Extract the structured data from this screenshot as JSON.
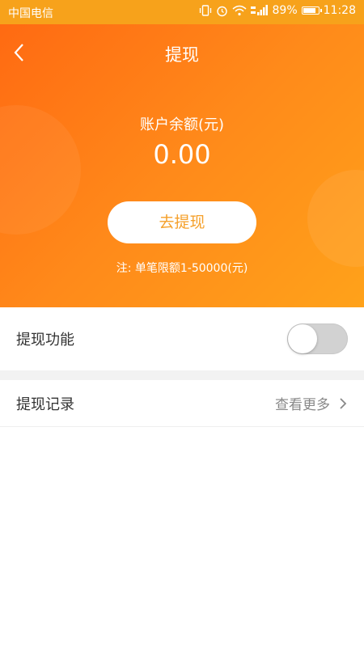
{
  "status_bar": {
    "carrier": "中国电信",
    "battery_level": "89%",
    "battery_fraction": 0.89,
    "time": "11:28"
  },
  "header": {
    "title": "提现"
  },
  "balance": {
    "label": "账户余额(元)",
    "value": "0.00"
  },
  "withdraw": {
    "button_label": "去提现",
    "limit_note": "注: 单笔限额1-50000(元)"
  },
  "settings": {
    "withdraw_function_label": "提现功能",
    "withdraw_function_enabled": false,
    "records_label": "提现记录",
    "records_more_label": "查看更多"
  },
  "colors": {
    "status_bar": "#f7a21b",
    "hero_start": "#ff6a12",
    "hero_end": "#ffa21a",
    "button_text": "#f5a02a",
    "toggle_off": "#d2d2d2"
  }
}
